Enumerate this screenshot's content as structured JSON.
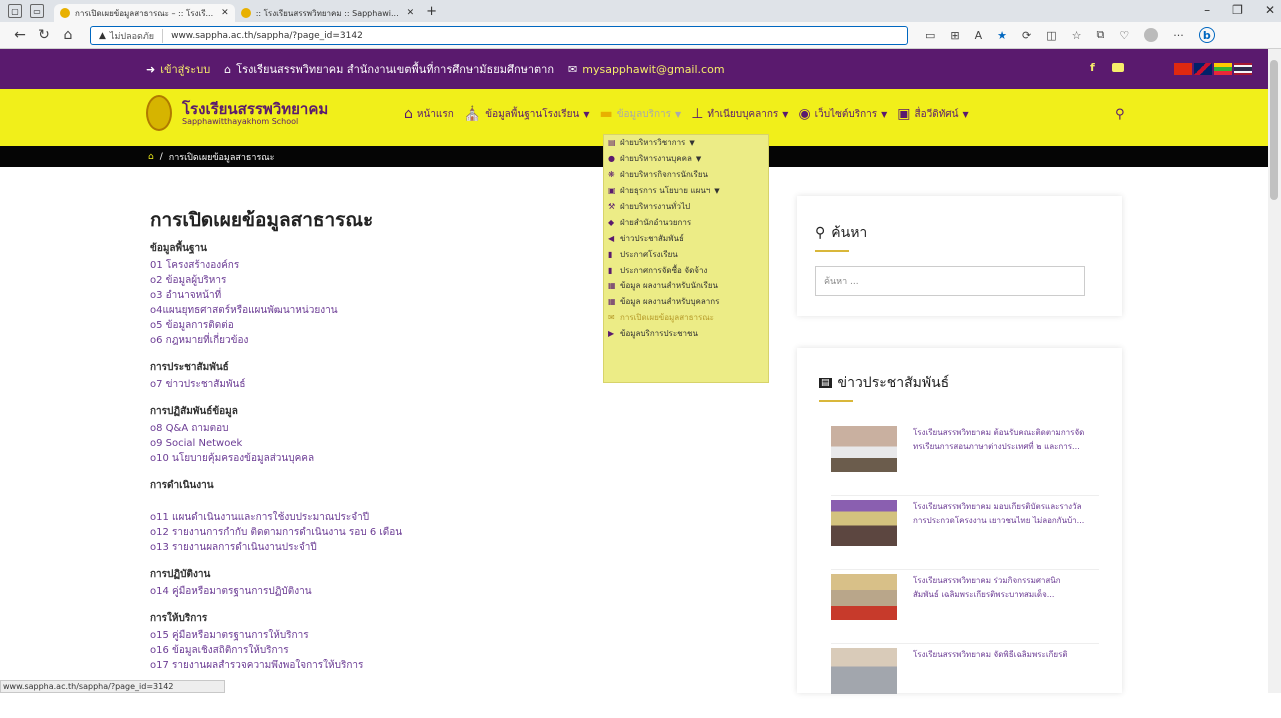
{
  "browser": {
    "tabs": [
      {
        "title": "การเปิดเผยข้อมูลสาธารณะ – :: โรงเรี..."
      },
      {
        "title": ":: โรงเรียนสรรพวิทยาคม :: Sapphawi..."
      }
    ],
    "address": {
      "security_label": "ไม่ปลอดภัย",
      "url": "www.sappha.ac.th/sappha/?page_id=3142"
    },
    "status_url": "www.sappha.ac.th/sappha/?page_id=3142"
  },
  "topstrip": {
    "login": "เข้าสู่ระบบ",
    "school_line": "โรงเรียนสรรพวิทยาคม สำนักงานเขตพื้นที่การศึกษามัธยมศึกษาตาก",
    "email": "mysapphawit@gmail.com"
  },
  "header": {
    "school_th": "โรงเรียนสรรพวิทยาคม",
    "school_en": "Sapphawitthayakhom School",
    "nav": [
      {
        "label": "หน้าแรก",
        "icon": "home-icon"
      },
      {
        "label": "ข้อมูลพื้นฐานโรงเรียน",
        "icon": "school-icon"
      },
      {
        "label": "ข้อมูลบริการ",
        "icon": "folder-icon"
      },
      {
        "label": "ทำเนียบบุคลากร",
        "icon": "org-chart-icon"
      },
      {
        "label": "เว็บไซต์บริการ",
        "icon": "globe-icon"
      },
      {
        "label": "สื่อวีดิทัศน์",
        "icon": "video-icon"
      }
    ]
  },
  "breadcrumb": {
    "current": "การเปิดเผยข้อมูลสาธารณะ"
  },
  "dropdown": {
    "items": [
      {
        "label": "ฝ่ายบริหารวิชาการ",
        "chevron": true
      },
      {
        "label": "ฝ่ายบริหารงานบุคคล",
        "chevron": true
      },
      {
        "label": "ฝ่ายบริหารกิจการนักเรียน",
        "chevron": false
      },
      {
        "label": "ฝ่ายธุรการ นโยบาย แผนฯ",
        "chevron": true
      },
      {
        "label": "ฝ่ายบริหารงานทั่วไป",
        "chevron": false
      },
      {
        "label": "ฝ่ายสำนักอำนวยการ",
        "chevron": false
      },
      {
        "label": "ข่าวประชาสัมพันธ์",
        "chevron": false
      },
      {
        "label": "ประกาศโรงเรียน",
        "chevron": false
      },
      {
        "label": "ประกาศการจัดซื้อ จัดจ้าง",
        "chevron": false
      },
      {
        "label": "ข้อมูล ผลงานสำหรับนักเรียน",
        "chevron": false
      },
      {
        "label": "ข้อมูล ผลงานสำหรับบุคลากร",
        "chevron": false
      },
      {
        "label": "การเปิดเผยข้อมูลสาธารณะ",
        "chevron": false
      },
      {
        "label": "ข้อมูลบริการประชาชน",
        "chevron": false
      }
    ]
  },
  "main": {
    "title": "การเปิดเผยข้อมูลสาธารณะ",
    "sections": [
      {
        "heading": "ข้อมูลพื้นฐาน",
        "links": [
          "01 โครงสร้างองค์กร",
          "o2 ข้อมูลผู้บริหาร",
          "o3 อำนาจหน้าที่",
          "o4แผนยุทธศาสตร์หรือแผนพัฒนาหน่วยงาน",
          "o5 ข้อมูลการติดต่อ",
          "o6 กฎหมายที่เกี่ยวข้อง"
        ]
      },
      {
        "heading": "การประชาสัมพันธ์",
        "links": [
          "o7 ข่าวประชาสัมพันธ์"
        ]
      },
      {
        "heading": "การปฏิสัมพันธ์ข้อมูล",
        "links": [
          "o8 Q&A ถามตอบ",
          "o9 Social Netwoek",
          "o10 นโยบายคุ้มครองข้อมูลส่วนบุคคล"
        ]
      },
      {
        "heading": "การดำเนินงาน",
        "links": [
          "",
          "o11 แผนดำเนินงานและการใช้งบประมาณประจำปี",
          "o12 รายงานการกำกับ ติดตามการดำเนินงาน รอบ 6 เดือน",
          "o13 รายงานผลการดำเนินงานประจำปี"
        ]
      },
      {
        "heading": "การปฏิบัติงาน",
        "links": [
          "o14 คู่มือหรือมาตรฐานการปฏิบัติงาน"
        ]
      },
      {
        "heading": "การให้บริการ",
        "links": [
          "o15 คู่มือหรือมาตรฐานการให้บริการ",
          "o16 ข้อมูลเชิงสถิติการให้บริการ",
          "o17 รายงานผลสำรวจความพึงพอใจการให้บริการ"
        ]
      }
    ]
  },
  "sidebar": {
    "search_title": "ค้นหา",
    "search_placeholder": "ค้นหา ...",
    "news_title": "ข่าวประชาสัมพันธ์",
    "news": [
      {
        "line1": "โรงเรียนสรรพวิทยาคม ต้อนรับคณะติดตามการจัด",
        "line2": "ทรเรียนการสอนภาษาต่างประเทศที่ ๒ และการ..."
      },
      {
        "line1": "โรงเรียนสรรพวิทยาคม มอบเกียรติบัตรและรางวัล",
        "line2": "การประกวดโครงงาน เยาวชนไทย ไม่ลอกกันบ้า..."
      },
      {
        "line1": "โรงเรียนสรรพวิทยาคม ร่วมกิจกรรมศาสนิก",
        "line2": "สัมพันธ์ เฉลิมพระเกียรติพระบาทสมเด็จ..."
      },
      {
        "line1": "โรงเรียนสรรพวิทยาคม จัดพิธีเฉลิมพระเกียรติ",
        "line2": ""
      }
    ]
  },
  "colors": {
    "purple": "#5a1a6e",
    "yellow": "#f1ef1a",
    "link": "#6b3b94",
    "dropdown_bg": "#ecec86"
  }
}
